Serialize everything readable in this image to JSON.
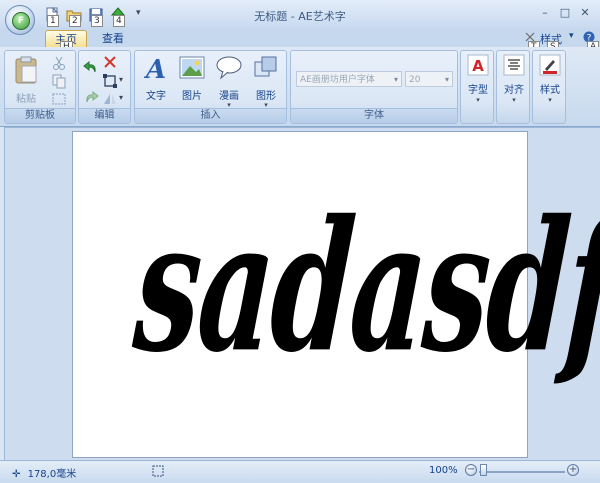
{
  "window": {
    "title": "无标题 - AE艺术字",
    "minimize": "–",
    "maximize": "□",
    "close": "✕"
  },
  "app_button": {
    "letter": "F"
  },
  "quick_access": {
    "keytips": [
      "1",
      "2",
      "3",
      "4"
    ],
    "dropdown": "▾"
  },
  "tabs": [
    {
      "label": "主页",
      "keytip": "H"
    },
    {
      "label": "查看"
    }
  ],
  "ribbon_right": {
    "style_menu": "样式",
    "style_keytip": "T",
    "s_keytip": "S",
    "help_keytip": "A"
  },
  "groups": {
    "clipboard": {
      "label": "剪贴板",
      "paste": "粘贴"
    },
    "edit": {
      "label": "编辑"
    },
    "insert": {
      "label": "插入",
      "text": "文字",
      "picture": "图片",
      "comic": "漫画",
      "shape": "图形"
    },
    "font": {
      "label": "字体",
      "font_name": "AE画册坊用户字体",
      "font_size": "20"
    },
    "format": {
      "glyph_type": "字型",
      "align": "对齐",
      "style": "样式"
    }
  },
  "canvas": {
    "art_text": "sadasdf"
  },
  "status": {
    "position": "178,0毫米",
    "zoom": "100%"
  },
  "colors": {
    "accent": "#15428b",
    "ribbon": "#dbe7f5",
    "active_tab": "#f6dc8f",
    "work_area": "#cddcee"
  }
}
